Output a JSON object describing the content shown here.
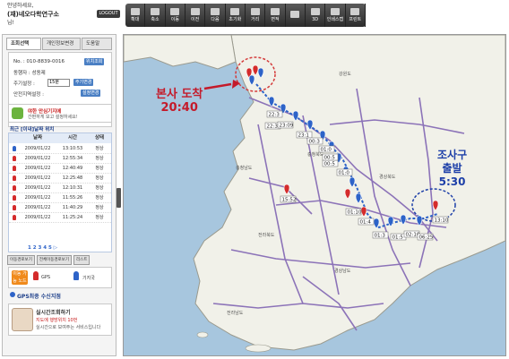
{
  "header": {
    "greeting": "안녕하세요,",
    "org_name": "(재)네오다학연구소",
    "user_suffix": "님!",
    "logout": "LOGOUT"
  },
  "toolbar": {
    "buttons": [
      {
        "label": "확대",
        "icon": "zoom-in-icon"
      },
      {
        "label": "축소",
        "icon": "zoom-out-icon"
      },
      {
        "label": "이동",
        "icon": "move-icon"
      },
      {
        "label": "이전",
        "icon": "prev-icon"
      },
      {
        "label": "다음",
        "icon": "next-icon"
      },
      {
        "label": "초기화",
        "icon": "reset-icon"
      },
      {
        "label": "거리",
        "icon": "distance-icon"
      },
      {
        "label": "면적",
        "icon": "area-icon"
      },
      {
        "label": "",
        "icon": "layer-icon"
      },
      {
        "label": "3D",
        "icon": "3d-icon"
      },
      {
        "label": "인쇄스캡",
        "icon": "print-icon"
      },
      {
        "label": "프린트",
        "icon": "printer-icon"
      }
    ]
  },
  "sidebar": {
    "tabs": [
      "조회선택",
      "개인정보변경",
      "도움말"
    ],
    "info": {
      "no_label": "No. : 010-8839-0016",
      "no_btn": "위치조회",
      "target_label": "동행자 : 성동제",
      "interval_label": "주기설정 :",
      "interval_value": "15분",
      "interval_btn": "주기변경",
      "safety_label": "안전지역설정 :",
      "safety_btn": "설정변경"
    },
    "promo": {
      "title": "야한 안심기지에",
      "subtitle": "간편하게 보고 설정하세요!"
    },
    "location_header": "최근 [이내]날짜 위치",
    "table": {
      "headers": [
        "날짜",
        "시간",
        "상태"
      ],
      "rows": [
        {
          "date": "2009/01/22",
          "time": "13:10:53",
          "status": "정상",
          "pin": "blue"
        },
        {
          "date": "2009/01/22",
          "time": "12:55:34",
          "status": "정상",
          "pin": "red"
        },
        {
          "date": "2009/01/22",
          "time": "12:40:49",
          "status": "정상",
          "pin": "red"
        },
        {
          "date": "2009/01/22",
          "time": "12:25:48",
          "status": "정상",
          "pin": "red"
        },
        {
          "date": "2009/01/22",
          "time": "12:10:31",
          "status": "정상",
          "pin": "red"
        },
        {
          "date": "2009/01/22",
          "time": "11:55:26",
          "status": "정상",
          "pin": "red"
        },
        {
          "date": "2009/01/22",
          "time": "11:40:29",
          "status": "정상",
          "pin": "red"
        },
        {
          "date": "2009/01/22",
          "time": "11:25:24",
          "status": "정상",
          "pin": "red"
        }
      ]
    },
    "pager": "1 2 3 4 5 ▷",
    "buttons": [
      "이동경로보기",
      "전체이동경로보기",
      "리스트"
    ],
    "legend": {
      "badge": "이동 가능 노드",
      "red_label": "GPS",
      "blue_label": "기지국"
    },
    "gps_link": "GPS최종 수신지점",
    "realtime": {
      "title": "실시간조회하기",
      "line1": "지도에 행방위치 10번",
      "line2": "실시간으로 보여주는 서비스입니다"
    }
  },
  "map": {
    "arrival": {
      "title": "본사 도착",
      "time": "20:40"
    },
    "departure": {
      "title": "조사구",
      "sub": "출발",
      "time": "5:30"
    },
    "time_labels": [
      "22:3",
      "22:3",
      "23:09",
      "23:1",
      "00:3",
      "01:0",
      "00:5",
      "01:0",
      "15:52",
      "01:10",
      "01:4",
      "01:3",
      "01:5",
      "02:10",
      "06:25",
      "13:10",
      "00:5"
    ],
    "region_labels": [
      "충청남도",
      "충청북도",
      "경상북도",
      "경상남도",
      "전라북도",
      "전라남도",
      "강원도"
    ]
  }
}
